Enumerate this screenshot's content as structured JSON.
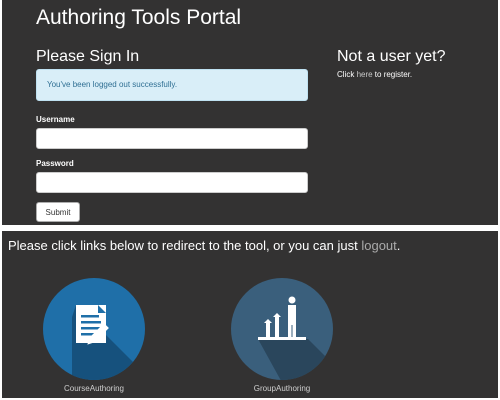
{
  "portal": {
    "title": "Authoring Tools Portal"
  },
  "signin": {
    "title": "Please Sign In",
    "alert": "You've been logged out successfully.",
    "username_label": "Username",
    "username_value": "",
    "password_label": "Password",
    "password_value": "",
    "submit_label": "Submit"
  },
  "register": {
    "title": "Not a user yet?",
    "prefix": "Click ",
    "link_text": "here",
    "suffix": " to register."
  },
  "redirect": {
    "text": "Please click links below to redirect to the tool, or you can just ",
    "logout_link": "logout",
    "end": "."
  },
  "tools": [
    {
      "label": "CourseAuthoring",
      "icon": "document-pen-icon",
      "color": "#1f6fa8"
    },
    {
      "label": "GroupAuthoring",
      "icon": "growth-chart-person-icon",
      "color": "#3a5f7c"
    }
  ],
  "colors": {
    "panel_background": "#333232",
    "alert_background": "#d9eef8",
    "alert_text": "#2f6f93"
  }
}
